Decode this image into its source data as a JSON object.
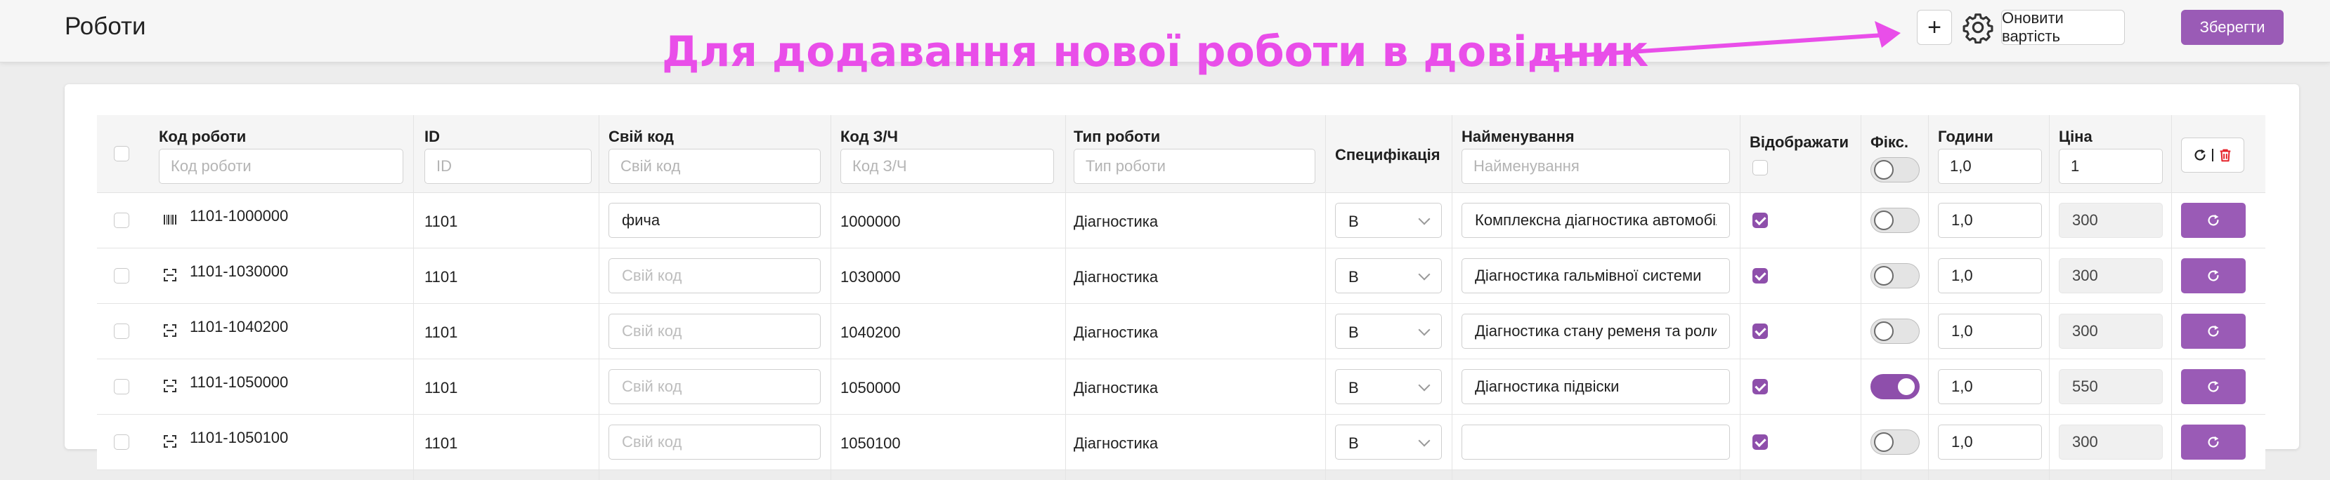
{
  "page": {
    "title": "Роботи"
  },
  "annotation": {
    "text": "Для додавання нової роботи в довідник",
    "color": "#e94ee9"
  },
  "toolbar": {
    "add_icon": "plus-icon",
    "add_label": "+",
    "settings_icon": "gear-icon",
    "update_price_label": "Оновити вартість",
    "save_label": "Зберегти"
  },
  "colors": {
    "accent": "#9a5bb6",
    "annotation": "#e94ee9"
  },
  "table": {
    "columns": {
      "code": {
        "label": "Код роботи",
        "placeholder": "Код роботи"
      },
      "id": {
        "label": "ID",
        "placeholder": "ID"
      },
      "own_code": {
        "label": "Свій код",
        "placeholder": "Свій код"
      },
      "part_code": {
        "label": "Код З/Ч",
        "placeholder": "Код З/Ч"
      },
      "work_type": {
        "label": "Тип роботи",
        "placeholder": "Тип роботи"
      },
      "spec": {
        "label": "Специфікація"
      },
      "name": {
        "label": "Найменування",
        "placeholder": "Найменування"
      },
      "display": {
        "label": "Відображати"
      },
      "fixed": {
        "label": "Фікс."
      },
      "hours": {
        "label": "Години",
        "value": "1,0"
      },
      "price": {
        "label": "Ціна",
        "value": "1"
      }
    },
    "own_code_placeholder": "Свій код",
    "rows": [
      {
        "code": "1101-1000000",
        "icon": "barcode-icon",
        "id": "1101",
        "own_code": "фича",
        "part_code": "1000000",
        "work_type": "Діагностика",
        "spec": "В",
        "name": "Комплексна діагностика автомобіля",
        "display": true,
        "fixed": false,
        "hours": "1,0",
        "price": "300"
      },
      {
        "code": "1101-1030000",
        "icon": "scan-icon",
        "id": "1101",
        "own_code": "",
        "part_code": "1030000",
        "work_type": "Діагностика",
        "spec": "В",
        "name": "Діагностика гальмівної системи",
        "display": true,
        "fixed": false,
        "hours": "1,0",
        "price": "300"
      },
      {
        "code": "1101-1040200",
        "icon": "scan-icon",
        "id": "1101",
        "own_code": "",
        "part_code": "1040200",
        "work_type": "Діагностика",
        "spec": "В",
        "name": "Діагностика стану ременя та ролика",
        "display": true,
        "fixed": false,
        "hours": "1,0",
        "price": "300"
      },
      {
        "code": "1101-1050000",
        "icon": "scan-icon",
        "id": "1101",
        "own_code": "",
        "part_code": "1050000",
        "work_type": "Діагностика",
        "spec": "В",
        "name": "Діагностика підвіски",
        "display": true,
        "fixed": true,
        "hours": "1,0",
        "price": "550"
      },
      {
        "code": "1101-1050100",
        "icon": "scan-icon",
        "id": "1101",
        "own_code": "",
        "part_code": "1050100",
        "work_type": "Діагностика",
        "spec": "В",
        "name": "",
        "display": true,
        "fixed": false,
        "hours": "1,0",
        "price": "300"
      }
    ]
  }
}
